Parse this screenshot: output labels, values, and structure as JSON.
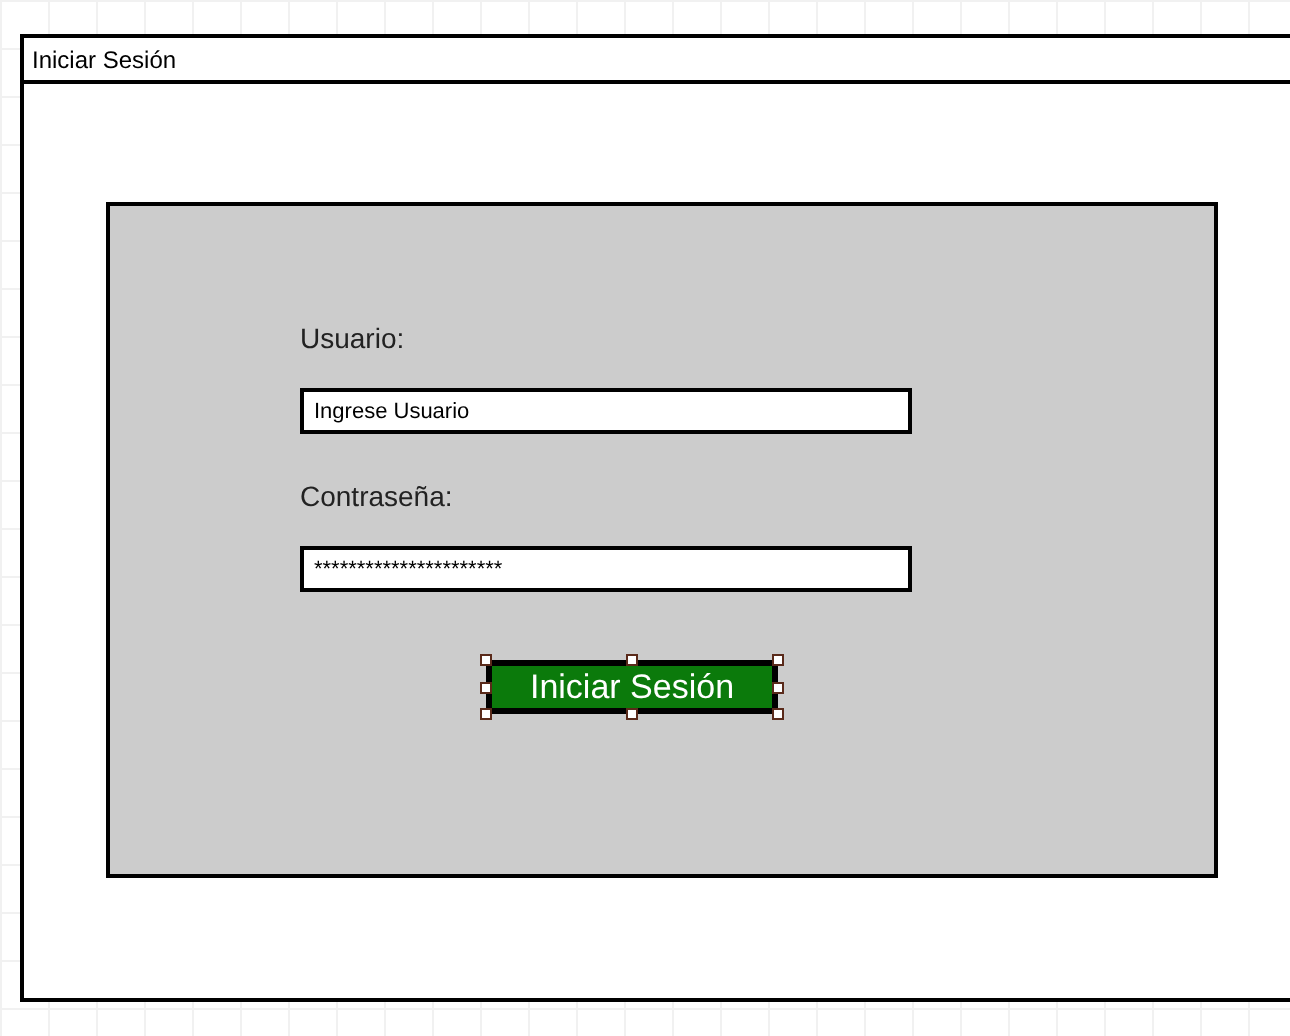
{
  "window": {
    "title": "Iniciar Sesión"
  },
  "form": {
    "fields": [
      {
        "label": "Usuario:",
        "value": "Ingrese Usuario"
      },
      {
        "label": "Contraseña:",
        "value": "**********************"
      }
    ],
    "button": {
      "label": "Iniciar Sesión",
      "selected": true
    }
  }
}
